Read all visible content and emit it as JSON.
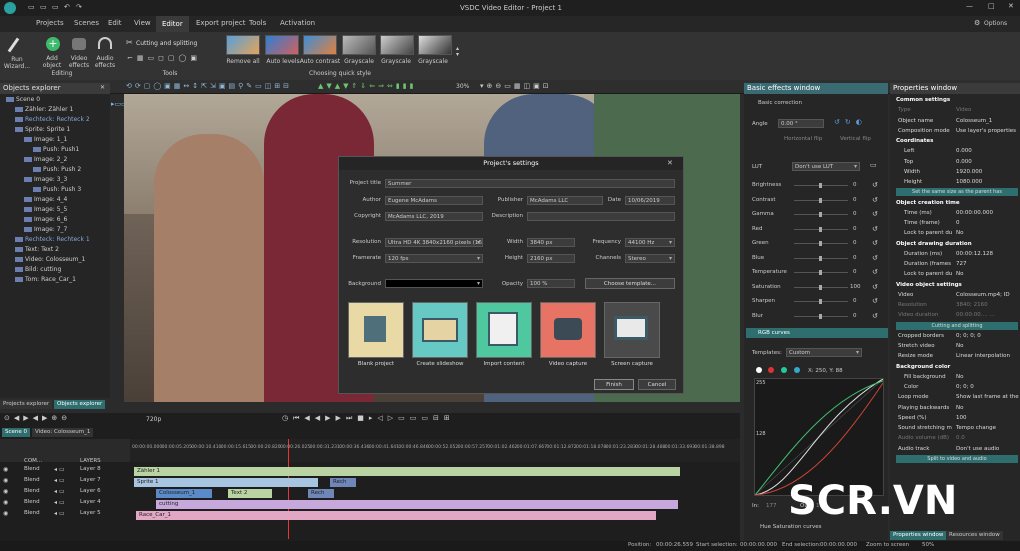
{
  "app": {
    "title": "VSDC Video Editor - Project 1",
    "options_label": "Options"
  },
  "menu": [
    "Projects",
    "Scenes",
    "Edit",
    "View",
    "Editor",
    "Export project",
    "Tools",
    "Activation"
  ],
  "ribbon": {
    "run_wizard": "Run Wizard...",
    "add_object": "Add object",
    "video_effects": "Video effects",
    "audio_effects": "Audio effects",
    "editing_group": "Editing",
    "cutting_splitting": "Cutting and splitting",
    "tools_group": "Tools",
    "quick_styles": [
      "Remove all",
      "Auto levels",
      "Auto contrast",
      "Grayscale",
      "Grayscale",
      "Grayscale"
    ],
    "quick_style_group": "Choosing quick style"
  },
  "toolbar2": {
    "zoom": "30%"
  },
  "objects_explorer": {
    "title": "Objects explorer",
    "items": [
      {
        "label": "Scene 0",
        "indent": 0
      },
      {
        "label": "Zähler: Zähler 1",
        "indent": 1
      },
      {
        "label": "Rechteck: Rechteck 2",
        "indent": 1
      },
      {
        "label": "Sprite: Sprite 1",
        "indent": 1
      },
      {
        "label": "Image: 1_1",
        "indent": 2
      },
      {
        "label": "Push: Push1",
        "indent": 3
      },
      {
        "label": "Image: 2_2",
        "indent": 2
      },
      {
        "label": "Push: Push 2",
        "indent": 3
      },
      {
        "label": "Image: 3_3",
        "indent": 2
      },
      {
        "label": "Push: Push 3",
        "indent": 3
      },
      {
        "label": "Image: 4_4",
        "indent": 2
      },
      {
        "label": "Image: 5_5",
        "indent": 2
      },
      {
        "label": "Image: 6_6",
        "indent": 2
      },
      {
        "label": "Image: 7_7",
        "indent": 2
      },
      {
        "label": "Rechteck: Rechteck 1",
        "indent": 1
      },
      {
        "label": "Text: Text 2",
        "indent": 1
      },
      {
        "label": "Video: Colosseum_1",
        "indent": 1
      },
      {
        "label": "Bild: cutting",
        "indent": 1
      },
      {
        "label": "Tom: Race_Car_1",
        "indent": 1
      }
    ],
    "bottom_tabs": [
      "Projects explorer",
      "Objects explorer"
    ]
  },
  "dialog": {
    "title": "Project's settings",
    "project_title_label": "Project title",
    "project_title": "Summer",
    "author_label": "Author",
    "author": "Eugene McAdams",
    "publisher_label": "Publisher",
    "publisher": "McAdams LLC",
    "date_label": "Date",
    "date": "10/06/2019",
    "copyright_label": "Copyright",
    "copyright": "McAdams LLC, 2019",
    "description_label": "Description",
    "description": "",
    "resolution_label": "Resolution",
    "resolution": "Ultra HD 4K 3840x2160 pixels (16",
    "width_label": "Width",
    "width": "3840 px",
    "frequency_label": "Frequency",
    "frequency": "44100 Hz",
    "framerate_label": "Framerate",
    "framerate": "120 fps",
    "height_label": "Height",
    "height": "2160 px",
    "channels_label": "Channels",
    "channels": "Stereo",
    "background_label": "Background",
    "opacity_label": "Opacity",
    "opacity": "100 %",
    "choose_template": "Choose template...",
    "tiles": [
      "Blank project",
      "Create slideshow",
      "Import content",
      "Video capture",
      "Screen capture"
    ],
    "finish": "Finish",
    "cancel": "Cancel"
  },
  "effects": {
    "title": "Basic effects window",
    "basic_correction": "Basic correction",
    "angle_label": "Angle",
    "angle": "0.00 °",
    "horizontal_flip": "Horizontal flip",
    "vertical_flip": "Vertical flip",
    "lut_label": "LUT",
    "lut": "Don't use LUT",
    "sliders": [
      {
        "label": "Brightness",
        "value": "0"
      },
      {
        "label": "Contrast",
        "value": "0"
      },
      {
        "label": "Gamma",
        "value": "0"
      },
      {
        "label": "Red",
        "value": "0"
      },
      {
        "label": "Green",
        "value": "0"
      },
      {
        "label": "Blue",
        "value": "0"
      },
      {
        "label": "Temperature",
        "value": "0"
      },
      {
        "label": "Saturation",
        "value": "100"
      },
      {
        "label": "Sharpen",
        "value": "0"
      },
      {
        "label": "Blur",
        "value": "0"
      }
    ],
    "rgb_curves": "RGB curves",
    "templates_label": "Templates:",
    "templates": "Custom",
    "coords": "X: 250, Y: 88",
    "curve_max": "255",
    "curve_mid": "128",
    "in_label": "In:",
    "in_value": "177",
    "out_label": "Out:",
    "out_value": "151",
    "hue_sat": "Hue Saturation curves"
  },
  "properties": {
    "title": "Properties window",
    "rows": [
      {
        "kind": "section",
        "key": "Common settings"
      },
      {
        "kind": "row",
        "key": "Type",
        "value": "Video",
        "dim": true
      },
      {
        "kind": "row",
        "key": "Object name",
        "value": "Colosseum_1"
      },
      {
        "kind": "row",
        "key": "Composition mode",
        "value": "Use layer's properties"
      },
      {
        "kind": "section",
        "key": "Coordinates"
      },
      {
        "kind": "row",
        "key": "Left",
        "value": "0.000",
        "sub": true
      },
      {
        "kind": "row",
        "key": "Top",
        "value": "0.000",
        "sub": true
      },
      {
        "kind": "row",
        "key": "Width",
        "value": "1920.000",
        "sub": true
      },
      {
        "kind": "row",
        "key": "Height",
        "value": "1080.000",
        "sub": true
      },
      {
        "kind": "button",
        "key": "Set the same size as the parent has"
      },
      {
        "kind": "section",
        "key": "Object creation time"
      },
      {
        "kind": "row",
        "key": "Time (ms)",
        "value": "00:00:00.000",
        "sub": true
      },
      {
        "kind": "row",
        "key": "Time (frame)",
        "value": "0",
        "sub": true
      },
      {
        "kind": "row",
        "key": "Lock to parent du",
        "value": "No",
        "sub": true
      },
      {
        "kind": "section",
        "key": "Object drawing duration"
      },
      {
        "kind": "row",
        "key": "Duration (ms)",
        "value": "00:00:12.128",
        "sub": true
      },
      {
        "kind": "row",
        "key": "Duration (frames",
        "value": "727",
        "sub": true
      },
      {
        "kind": "row",
        "key": "Lock to parent du",
        "value": "No",
        "sub": true
      },
      {
        "kind": "section",
        "key": "Video object settings"
      },
      {
        "kind": "row",
        "key": "Video",
        "value": "Colosseum.mp4; ID"
      },
      {
        "kind": "row",
        "key": "Resolution",
        "value": "3840; 2160",
        "dim": true
      },
      {
        "kind": "row",
        "key": "Video duration",
        "value": "00:00:00.... ...",
        "dim": true
      },
      {
        "kind": "button",
        "key": "Cutting and splitting"
      },
      {
        "kind": "row",
        "key": "Cropped borders",
        "value": "0; 0; 0; 0"
      },
      {
        "kind": "row",
        "key": "Stretch video",
        "value": "No"
      },
      {
        "kind": "row",
        "key": "Resize mode",
        "value": "Linear interpolation"
      },
      {
        "kind": "section",
        "key": "Background color"
      },
      {
        "kind": "row",
        "key": "Fill background",
        "value": "No",
        "sub": true
      },
      {
        "kind": "row",
        "key": "Color",
        "value": "0; 0; 0",
        "sub": true
      },
      {
        "kind": "row",
        "key": "Loop mode",
        "value": "Show last frame at the"
      },
      {
        "kind": "row",
        "key": "Playing backwards",
        "value": "No"
      },
      {
        "kind": "row",
        "key": "Speed (%)",
        "value": "100"
      },
      {
        "kind": "row",
        "key": "Sound stretching m",
        "value": "Tempo change"
      },
      {
        "kind": "row",
        "key": "Audio volume (dB)",
        "value": "0.0",
        "dim": true
      },
      {
        "kind": "row",
        "key": "Audio track",
        "value": "Don't use audio"
      },
      {
        "kind": "button",
        "key": "Split to video and audio"
      }
    ],
    "bottom_tabs": [
      "Properties window",
      "Resources window"
    ]
  },
  "timeline": {
    "scene_tab": "Scene 0",
    "video_tab": "Video: Colosseum_1",
    "resolution": "720p",
    "com_label": "COM...",
    "layers_label": "LAYERS",
    "ticks": [
      "00:00:00.000",
      "00:00:05.205",
      "00:00:10.410",
      "00:00:15.615",
      "00:00:20.820",
      "00:00:26.025",
      "00:00:31.231",
      "00:00:36.436",
      "00:00:41.641",
      "00:00:46.846",
      "00:00:52.052",
      "00:00:57.257",
      "00:01:02.462",
      "00:01:07.667",
      "00:01:12.872",
      "00:01:18.078",
      "00:01:23.283",
      "00:01:28.488",
      "00:01:33.693",
      "00:01:38.898"
    ],
    "layers": [
      {
        "blend": "Blend",
        "name": "Layer 8"
      },
      {
        "blend": "Blend",
        "name": "Layer 7"
      },
      {
        "blend": "Blend",
        "name": "Layer 6"
      },
      {
        "blend": "Blend",
        "name": "Layer 4"
      },
      {
        "blend": "Blend",
        "name": "Layer 5"
      }
    ],
    "clips": [
      "Zähler 1",
      "Sprite 1",
      "Rech",
      "Colosseum_1",
      "Text 2",
      "Rech",
      "cutting",
      "Race_Car_1"
    ]
  },
  "status": {
    "position_label": "Position:",
    "position": "00:00:26.559",
    "start_label": "Start selection:",
    "start": "00:00:00.000",
    "end_label": "End selection:",
    "end": "00:00:00.000",
    "zoom_label": "Zoom to screen",
    "zoom": "50%"
  },
  "watermark": "SCR.VN"
}
